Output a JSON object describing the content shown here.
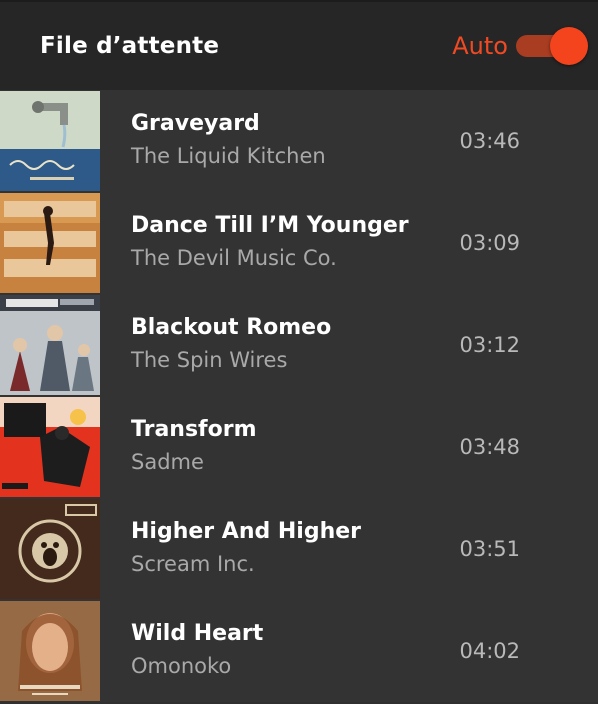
{
  "header": {
    "title": "File d’attente",
    "auto_label": "Auto",
    "auto_enabled": true
  },
  "colors": {
    "accent": "#f4441d",
    "header_bg": "#262626",
    "row_bg": "#333333"
  },
  "queue": [
    {
      "title": "Graveyard",
      "artist": "The Liquid Kitchen",
      "duration": "03:46"
    },
    {
      "title": "Dance Till I’M Younger",
      "artist": "The Devil Music Co.",
      "duration": "03:09"
    },
    {
      "title": "Blackout Romeo",
      "artist": "The Spin Wires",
      "duration": "03:12"
    },
    {
      "title": "Transform",
      "artist": "Sadme",
      "duration": "03:48"
    },
    {
      "title": "Higher And Higher",
      "artist": "Scream Inc.",
      "duration": "03:51"
    },
    {
      "title": "Wild Heart",
      "artist": "Omonoko",
      "duration": "04:02"
    }
  ]
}
